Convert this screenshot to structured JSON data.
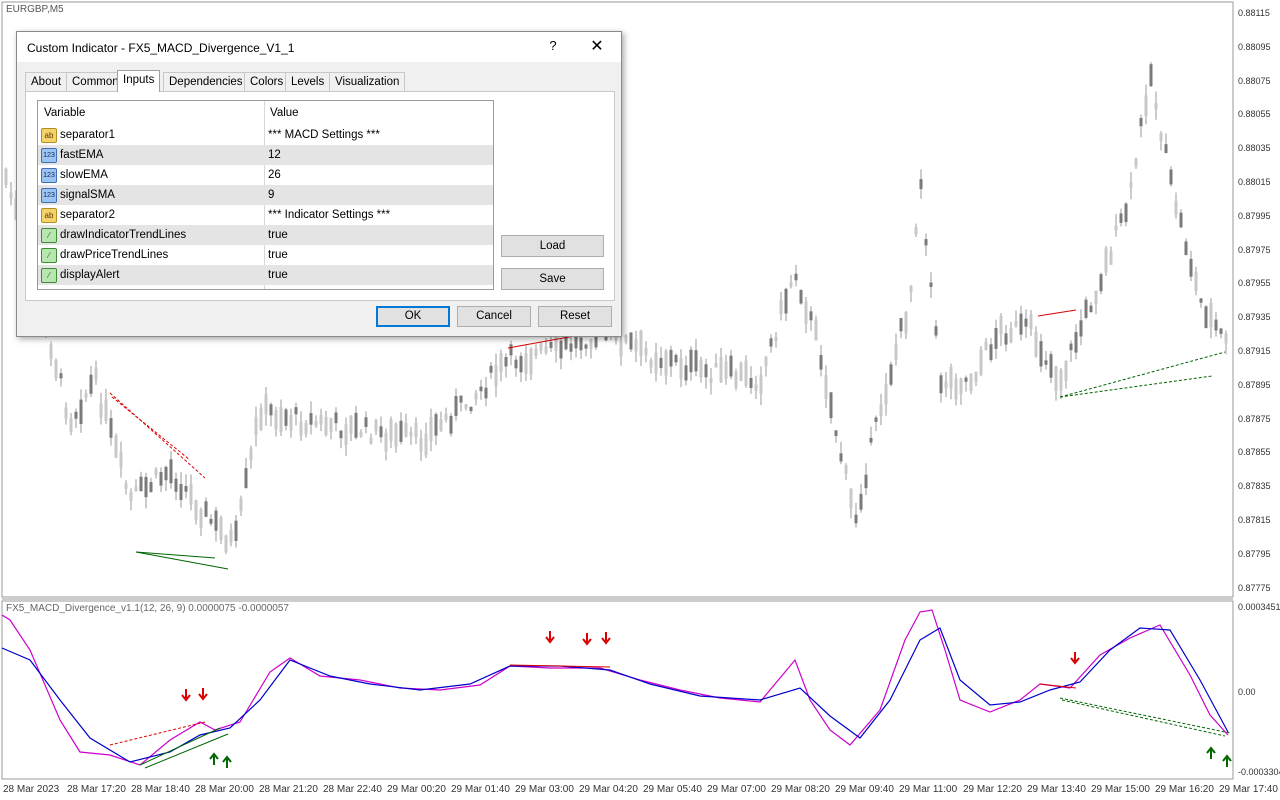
{
  "chart": {
    "symbol": "EURGBP,M5",
    "indicator_label": "FX5_MACD_Divergence_v1.1(12, 26, 9) 0.0000075 -0.0000057",
    "price_ticks": [
      "0.88115",
      "0.88095",
      "0.88075",
      "0.88055",
      "0.88035",
      "0.88015",
      "0.87995",
      "0.87975",
      "0.87955",
      "0.87935",
      "0.87915",
      "0.87895",
      "0.87875",
      "0.87855",
      "0.87835",
      "0.87815",
      "0.87795",
      "0.87775"
    ],
    "indicator_ticks": [
      "0.0003451",
      "0.00",
      "-0.0003304"
    ],
    "time_ticks": [
      "28 Mar 2023",
      "28 Mar 17:20",
      "28 Mar 18:40",
      "28 Mar 20:00",
      "28 Mar 21:20",
      "28 Mar 22:40",
      "29 Mar 00:20",
      "29 Mar 01:40",
      "29 Mar 03:00",
      "29 Mar 04:20",
      "29 Mar 05:40",
      "29 Mar 07:00",
      "29 Mar 08:20",
      "29 Mar 09:40",
      "29 Mar 11:00",
      "29 Mar 12:20",
      "29 Mar 13:40",
      "29 Mar 15:00",
      "29 Mar 16:20",
      "29 Mar 17:40"
    ],
    "colors": {
      "candle": "#808080",
      "macd": "#cc00cc",
      "signal": "#0000cc",
      "bear": "#dd0000",
      "bull": "#006600"
    }
  },
  "dialog": {
    "title": "Custom Indicator - FX5_MACD_Divergence_V1_1",
    "help": "?",
    "close": "✕",
    "tabs": [
      "About",
      "Common",
      "Inputs",
      "Dependencies",
      "Colors",
      "Levels",
      "Visualization"
    ],
    "active_tab": "Inputs",
    "grid": {
      "headers": [
        "Variable",
        "Value"
      ],
      "rows": [
        {
          "icon": "string-icon",
          "icon_text": "ab",
          "name": "separator1",
          "value": "*** MACD Settings ***"
        },
        {
          "icon": "number-icon",
          "icon_text": "123",
          "name": "fastEMA",
          "value": "12"
        },
        {
          "icon": "number-icon",
          "icon_text": "123",
          "name": "slowEMA",
          "value": "26"
        },
        {
          "icon": "number-icon",
          "icon_text": "123",
          "name": "signalSMA",
          "value": "9"
        },
        {
          "icon": "string-icon",
          "icon_text": "ab",
          "name": "separator2",
          "value": "*** Indicator Settings ***"
        },
        {
          "icon": "bool-icon",
          "icon_text": "⁄",
          "name": "drawIndicatorTrendLines",
          "value": "true"
        },
        {
          "icon": "bool-icon",
          "icon_text": "⁄",
          "name": "drawPriceTrendLines",
          "value": "true"
        },
        {
          "icon": "bool-icon",
          "icon_text": "⁄",
          "name": "displayAlert",
          "value": "true"
        }
      ]
    },
    "buttons": {
      "load": "Load",
      "save": "Save",
      "ok": "OK",
      "cancel": "Cancel",
      "reset": "Reset"
    }
  }
}
